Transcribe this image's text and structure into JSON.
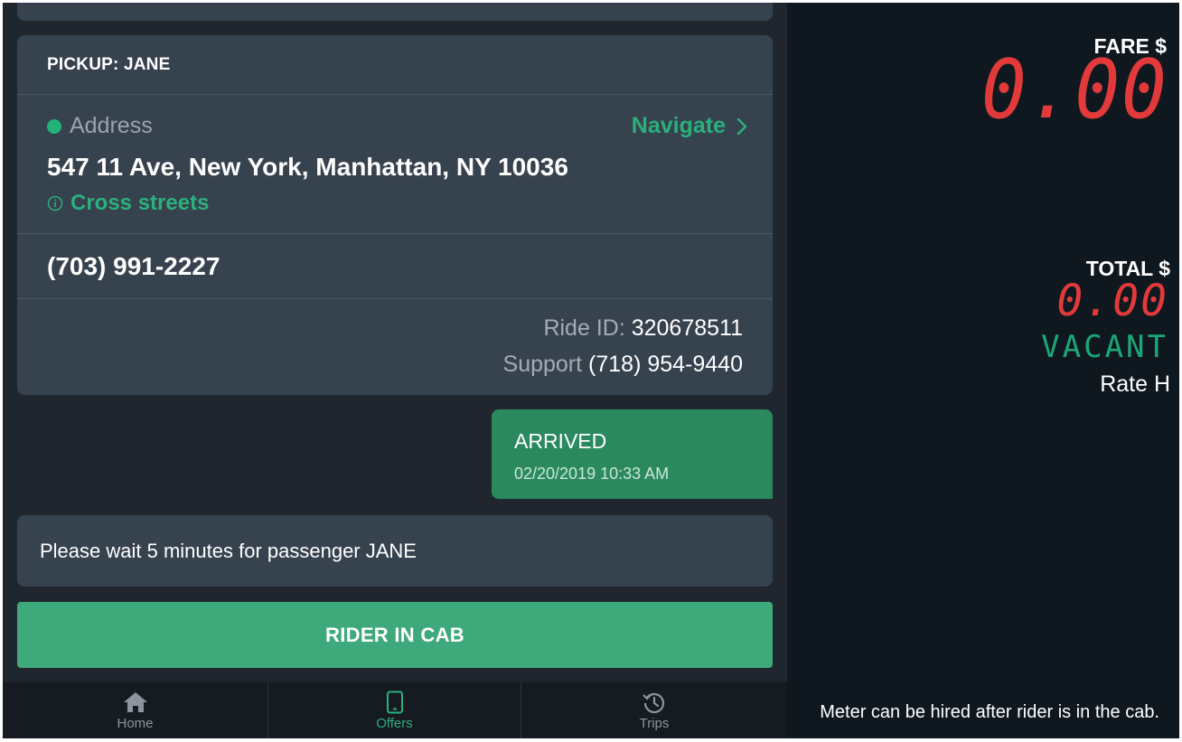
{
  "pickup": {
    "title": "PICKUP: JANE",
    "address_label": "Address",
    "navigate_label": "Navigate",
    "address": "547 11 Ave, New York, Manhattan, NY 10036",
    "cross_streets_label": "Cross streets",
    "phone": "(703) 991-2227",
    "ride_id_label": "Ride ID:",
    "ride_id": "320678511",
    "support_label": "Support",
    "support_phone": "(718) 954-9440"
  },
  "status": {
    "title": "ARRIVED",
    "timestamp": "02/20/2019 10:33 AM"
  },
  "wait_message": "Please wait 5 minutes for passenger JANE",
  "action_button_label": "RIDER IN CAB",
  "nav": {
    "items": [
      {
        "label": "Home",
        "icon": "home-icon"
      },
      {
        "label": "Offers",
        "icon": "phone-icon",
        "active": true
      },
      {
        "label": "Trips",
        "icon": "history-icon"
      }
    ]
  },
  "meter": {
    "fare_label": "FARE $",
    "fare_value": "0.00",
    "total_label": "TOTAL $",
    "total_value": "0.00",
    "status": "VACANT",
    "rate": "Rate H",
    "note": "Meter can be hired after rider is in the cab."
  },
  "colors": {
    "accent_green": "#2bb07c",
    "button_green": "#3ea97b",
    "meter_red": "#e23a3a",
    "card_bg": "#36424e",
    "panel_bg": "#1f262e"
  }
}
